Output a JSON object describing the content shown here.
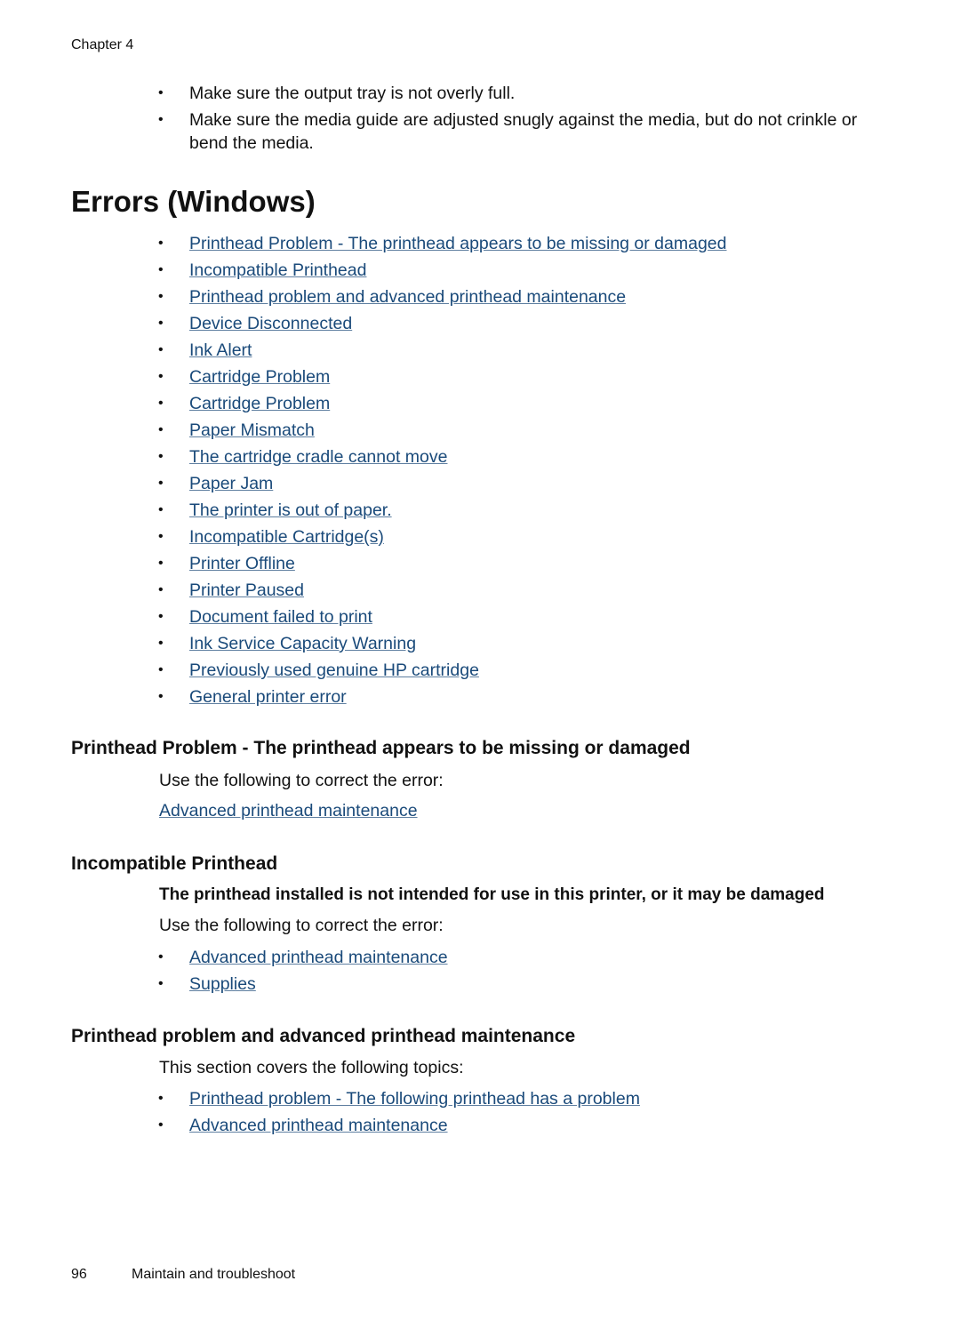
{
  "header": {
    "chapter": "Chapter 4"
  },
  "intro_bullets": [
    "Make sure the output tray is not overly full.",
    "Make sure the media guide are adjusted snugly against the media, but do not crinkle or bend the media."
  ],
  "errors_section": {
    "title": "Errors (Windows)",
    "links": [
      "Printhead Problem - The printhead appears to be missing or damaged",
      "Incompatible Printhead",
      "Printhead problem and advanced printhead maintenance",
      "Device Disconnected",
      "Ink Alert",
      "Cartridge Problem",
      "Cartridge Problem",
      "Paper Mismatch",
      "The cartridge cradle cannot move",
      "Paper Jam",
      "The printer is out of paper.",
      "Incompatible Cartridge(s)",
      "Printer Offline",
      "Printer Paused",
      "Document failed to print",
      "Ink Service Capacity Warning",
      "Previously used genuine HP cartridge",
      "General printer error"
    ]
  },
  "printhead_missing": {
    "title": "Printhead Problem - The printhead appears to be missing or damaged",
    "instruction": "Use the following to correct the error:",
    "link": "Advanced printhead maintenance"
  },
  "incompatible_printhead": {
    "title": "Incompatible Printhead",
    "bold_text": "The printhead installed is not intended for use in this printer, or it may be damaged",
    "instruction": "Use the following to correct the error:",
    "links": [
      "Advanced printhead maintenance",
      "Supplies"
    ]
  },
  "printhead_maintenance": {
    "title": "Printhead problem and advanced printhead maintenance",
    "intro": "This section covers the following topics:",
    "links": [
      "Printhead problem - The following printhead has a problem",
      "Advanced printhead maintenance"
    ]
  },
  "footer": {
    "page_number": "96",
    "section": "Maintain and troubleshoot"
  },
  "bullet_glyph": "•",
  "colors": {
    "link": "#1a4a7a",
    "text": "#111111"
  }
}
